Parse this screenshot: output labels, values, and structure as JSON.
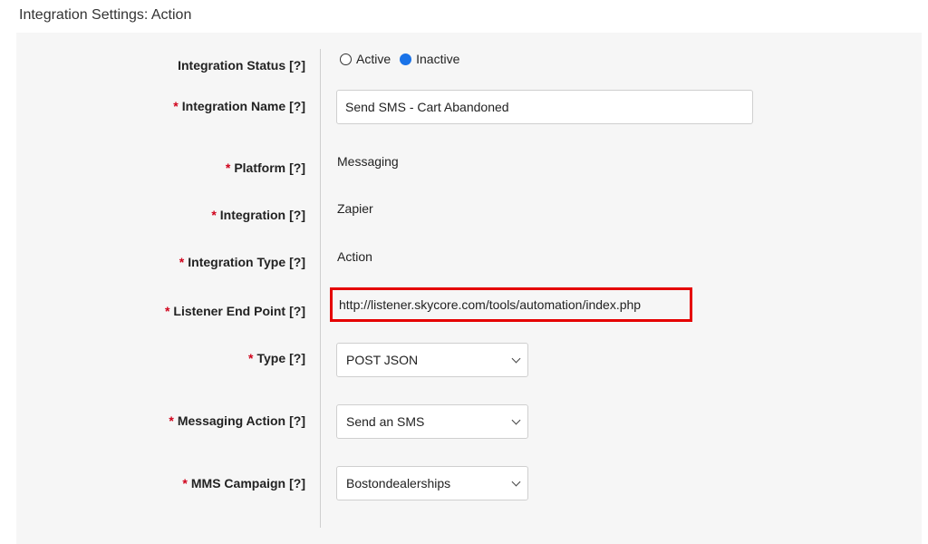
{
  "page": {
    "title": "Integration Settings: Action"
  },
  "form": {
    "required_mark": "*",
    "help_mark": "[?]",
    "status": {
      "label": "Integration Status",
      "options": [
        "Active",
        "Inactive"
      ],
      "selected": "Inactive"
    },
    "name": {
      "label": "Integration Name",
      "value": "Send SMS - Cart Abandoned"
    },
    "platform": {
      "label": "Platform",
      "value": "Messaging"
    },
    "integration": {
      "label": "Integration",
      "value": "Zapier"
    },
    "integration_type": {
      "label": "Integration Type",
      "value": "Action"
    },
    "listener": {
      "label": "Listener End Point",
      "value": "http://listener.skycore.com/tools/automation/index.php"
    },
    "type": {
      "label": "Type",
      "value": "POST JSON"
    },
    "messaging_action": {
      "label": "Messaging Action",
      "value": "Send an SMS"
    },
    "mms_campaign": {
      "label": "MMS Campaign",
      "value": "Bostondealerships"
    }
  },
  "colors": {
    "highlight": "#e50000",
    "radio_selected": "#1a73e8",
    "required": "#d0021b"
  }
}
